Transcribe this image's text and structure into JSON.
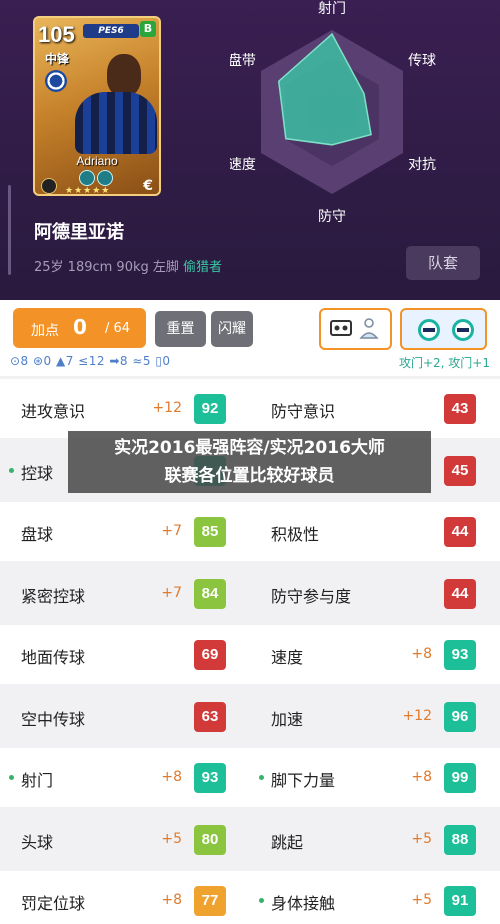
{
  "card": {
    "rating": "105",
    "position": "中锋",
    "name": "Adriano",
    "logo": "PES6",
    "tier": "B",
    "stars": "★★★★★",
    "euro": "€"
  },
  "player": {
    "name": "阿德里亚诺",
    "info": "25岁 189cm 90kg 左脚",
    "role": "偷猎者",
    "kit_button": "队套"
  },
  "radar": {
    "labels": [
      "射门",
      "传球",
      "对抗",
      "防守",
      "速度",
      "盘带"
    ],
    "values": [
      0.95,
      0.45,
      0.55,
      0.4,
      0.65,
      0.75
    ],
    "fill": "#3dbfa3",
    "ring_color": "#5a3f73"
  },
  "controls": {
    "add_points_label": "加点",
    "add_points_current": "0",
    "add_points_total": "/ 64",
    "reset_label": "重置",
    "shine_label": "闪耀",
    "stat_line": "⊙8 ⊛0 ▲7 ≤12 ➡8 ≈5 ▯0",
    "attack_line": "攻门+2, 攻门+1"
  },
  "stats_rows": [
    [
      {
        "name": "进攻意识",
        "bonus": "+12",
        "value": "92",
        "color": "#1dbf98",
        "dot": false
      },
      {
        "name": "防守意识",
        "bonus": "",
        "value": "43",
        "color": "#d23a3a",
        "dot": false
      }
    ],
    [
      {
        "name": "控球",
        "bonus": "",
        "value": "",
        "color": "#1dbf98",
        "dot": true
      },
      {
        "name": "",
        "bonus": "",
        "value": "45",
        "color": "#d23a3a",
        "dot": false
      }
    ],
    [
      {
        "name": "盘球",
        "bonus": "+7",
        "value": "85",
        "color": "#8bc53f",
        "dot": false
      },
      {
        "name": "积极性",
        "bonus": "",
        "value": "44",
        "color": "#d23a3a",
        "dot": false
      }
    ],
    [
      {
        "name": "紧密控球",
        "bonus": "+7",
        "value": "84",
        "color": "#8bc53f",
        "dot": false
      },
      {
        "name": "防守参与度",
        "bonus": "",
        "value": "44",
        "color": "#d23a3a",
        "dot": false
      }
    ],
    [
      {
        "name": "地面传球",
        "bonus": "",
        "value": "69",
        "color": "#d23a3a",
        "dot": false
      },
      {
        "name": "速度",
        "bonus": "+8",
        "value": "93",
        "color": "#1dbf98",
        "dot": false
      }
    ],
    [
      {
        "name": "空中传球",
        "bonus": "",
        "value": "63",
        "color": "#d23a3a",
        "dot": false
      },
      {
        "name": "加速",
        "bonus": "+12",
        "value": "96",
        "color": "#1dbf98",
        "dot": false
      }
    ],
    [
      {
        "name": "射门",
        "bonus": "+8",
        "value": "93",
        "color": "#1dbf98",
        "dot": true
      },
      {
        "name": "脚下力量",
        "bonus": "+8",
        "value": "99",
        "color": "#1dbf98",
        "dot": true
      }
    ],
    [
      {
        "name": "头球",
        "bonus": "+5",
        "value": "80",
        "color": "#8bc53f",
        "dot": false
      },
      {
        "name": "跳起",
        "bonus": "+5",
        "value": "88",
        "color": "#1dbf98",
        "dot": false
      }
    ],
    [
      {
        "name": "罚定位球",
        "bonus": "+8",
        "value": "77",
        "color": "#f0a22e",
        "dot": false
      },
      {
        "name": "身体接触",
        "bonus": "+5",
        "value": "91",
        "color": "#1dbf98",
        "dot": true
      }
    ]
  ],
  "overlay": {
    "line1": "实况2016最强阵容/实况2016大师",
    "line2": "联赛各位置比较好球员"
  }
}
